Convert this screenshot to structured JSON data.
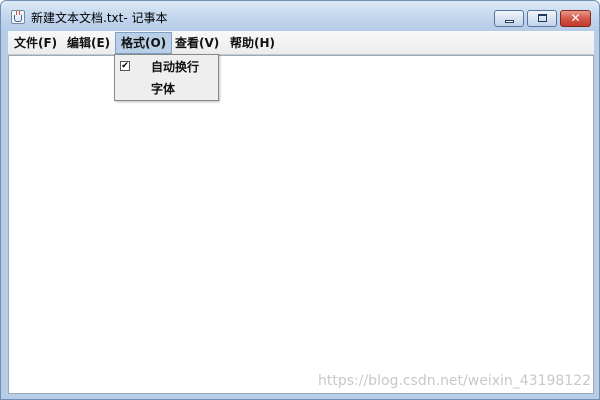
{
  "window": {
    "title": "新建文本文档.txt- 记事本",
    "close_symbol": "✕"
  },
  "menubar": {
    "items": [
      {
        "label": "文件(F)"
      },
      {
        "label": "编辑(E)"
      },
      {
        "label": "格式(O)",
        "active": true
      },
      {
        "label": "查看(V)"
      },
      {
        "label": "帮助(H)"
      }
    ]
  },
  "format_menu": {
    "items": [
      {
        "label": "自动换行",
        "checked": true,
        "check_mark": "✔"
      },
      {
        "label": "字体",
        "checked": false
      }
    ]
  },
  "editor": {
    "content": ""
  },
  "watermark": {
    "text": "https://blog.csdn.net/weixin_43198122"
  },
  "colors": {
    "frame": "#b7cde6",
    "menu_active": "#b8cfe5",
    "close_button": "#c23a2c"
  },
  "icons": [
    "java-app-icon",
    "minimize-icon",
    "maximize-icon",
    "close-icon",
    "checkbox-checked-icon"
  ]
}
